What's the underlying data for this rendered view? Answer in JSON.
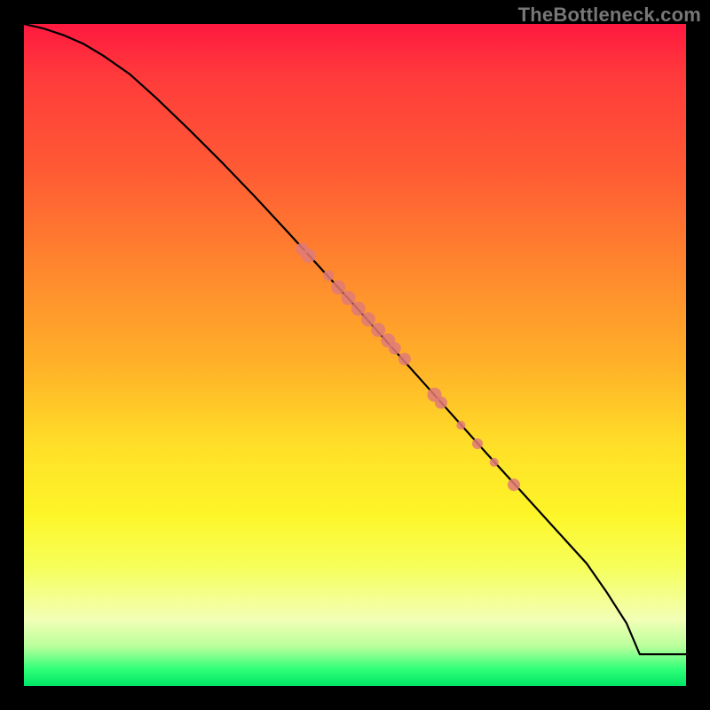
{
  "watermark": "TheBottleneck.com",
  "chart_data": {
    "type": "line",
    "title": "",
    "xlabel": "",
    "ylabel": "",
    "xlim": [
      0,
      100
    ],
    "ylim": [
      0,
      100
    ],
    "grid": false,
    "series": [
      {
        "name": "curve",
        "style": "line",
        "x": [
          0,
          3,
          6,
          9,
          12,
          16,
          20,
          25,
          30,
          35,
          40,
          45,
          50,
          55,
          60,
          65,
          70,
          75,
          80,
          85,
          88,
          91,
          93,
          100
        ],
        "y": [
          100,
          99.3,
          98.3,
          97.0,
          95.2,
          92.4,
          88.8,
          84.0,
          79.0,
          73.8,
          68.4,
          62.9,
          57.4,
          51.8,
          46.2,
          40.6,
          35.0,
          29.5,
          24.0,
          18.5,
          14.2,
          9.5,
          4.8,
          4.8
        ]
      },
      {
        "name": "dots",
        "style": "scatter",
        "points": [
          {
            "x": 42,
            "y": 66.0,
            "r": 7
          },
          {
            "x": 43,
            "y": 65.0,
            "r": 8
          },
          {
            "x": 46,
            "y": 62.0,
            "r": 6
          },
          {
            "x": 47.5,
            "y": 60.2,
            "r": 8
          },
          {
            "x": 49,
            "y": 58.6,
            "r": 8
          },
          {
            "x": 50.5,
            "y": 57.0,
            "r": 8
          },
          {
            "x": 52,
            "y": 55.4,
            "r": 8
          },
          {
            "x": 53.5,
            "y": 53.8,
            "r": 8
          },
          {
            "x": 55,
            "y": 52.2,
            "r": 8
          },
          {
            "x": 56,
            "y": 51.0,
            "r": 7
          },
          {
            "x": 57.5,
            "y": 49.4,
            "r": 7
          },
          {
            "x": 62,
            "y": 44.0,
            "r": 8
          },
          {
            "x": 63,
            "y": 42.8,
            "r": 7
          },
          {
            "x": 66,
            "y": 39.4,
            "r": 5
          },
          {
            "x": 68.5,
            "y": 36.6,
            "r": 6
          },
          {
            "x": 71,
            "y": 33.8,
            "r": 5
          },
          {
            "x": 74,
            "y": 30.4,
            "r": 7
          }
        ]
      }
    ],
    "gradient_top_color": "#ff1940",
    "gradient_bottom_color": "#00e566"
  }
}
